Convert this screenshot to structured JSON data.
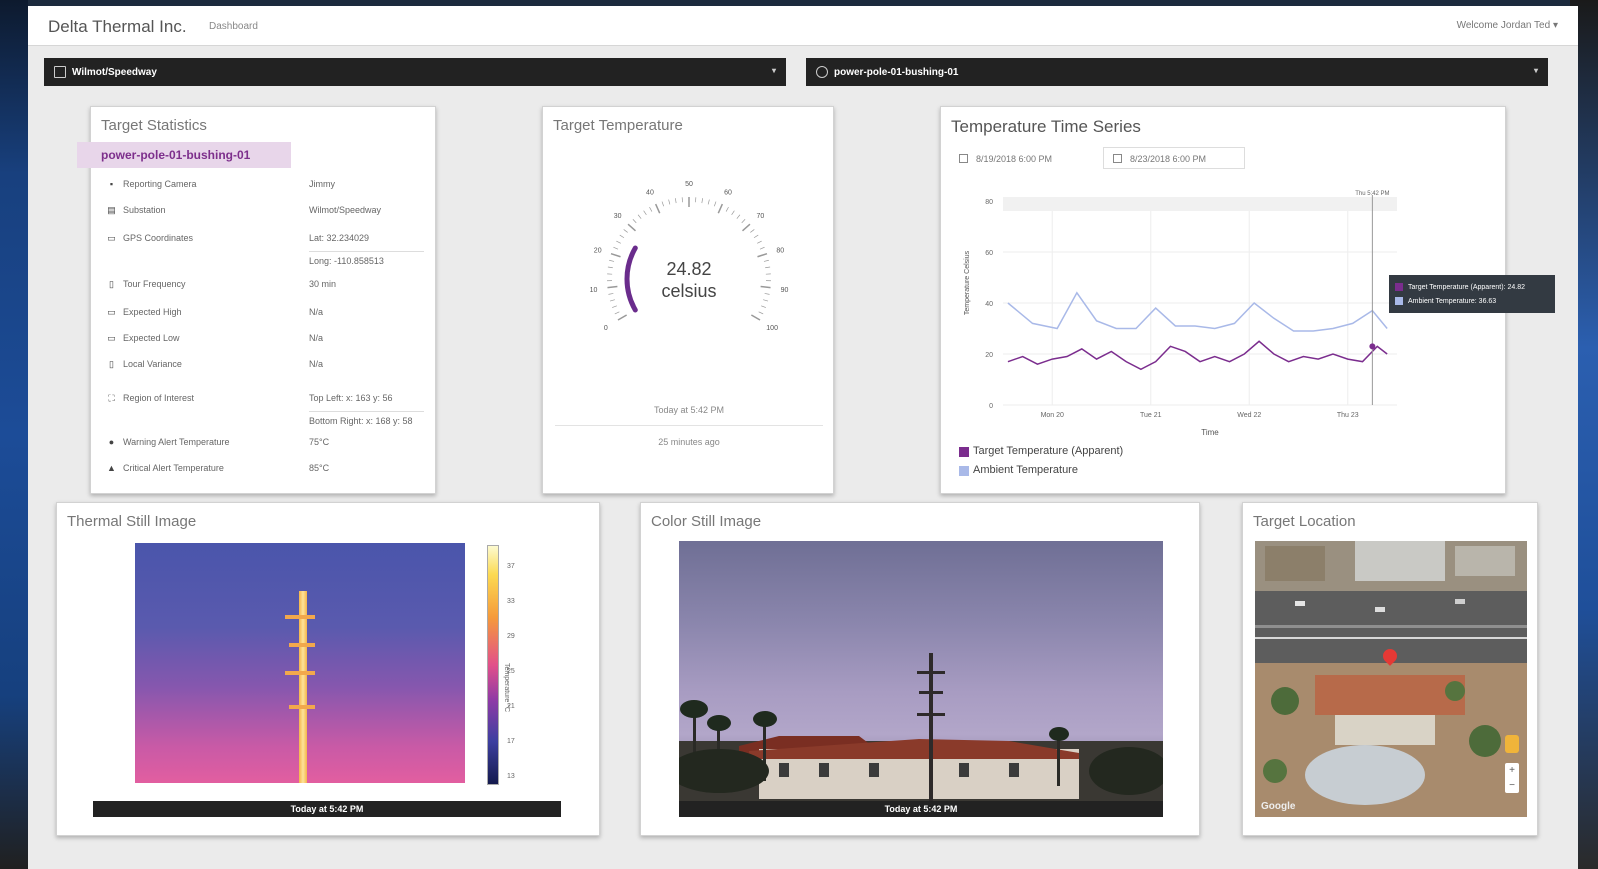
{
  "app": {
    "brand": "Delta Thermal Inc.",
    "crumb": "Dashboard",
    "welcome": "Welcome Jordan Ted"
  },
  "selectors": {
    "substation": "Wilmot/Speedway",
    "target": "power-pole-01-bushing-01"
  },
  "stats": {
    "title": "Target Statistics",
    "target_tag": "power-pole-01-bushing-01",
    "rows": [
      {
        "icon": "camera-icon",
        "label": "Reporting Camera",
        "value": "Jimmy"
      },
      {
        "icon": "building-icon",
        "label": "Substation",
        "value": "Wilmot/Speedway"
      },
      {
        "icon": "globe-icon",
        "label": "GPS Coordinates",
        "value": "Lat: 32.234029",
        "value2": "Long: -110.858513"
      },
      {
        "icon": "clock-icon",
        "label": "Tour Frequency",
        "value": "30 min"
      },
      {
        "icon": "arrow-up-icon",
        "label": "Expected High",
        "value": "N/a"
      },
      {
        "icon": "arrow-down-icon",
        "label": "Expected Low",
        "value": "N/a"
      },
      {
        "icon": "sigma-icon",
        "label": "Local Variance",
        "value": "N/a"
      },
      {
        "icon": "region-icon",
        "label": "Region of Interest",
        "value": "Top Left: x: 163 y: 56",
        "value2": "Bottom Right: x: 168 y: 58"
      },
      {
        "icon": "warning-circle-icon",
        "label": "Warning Alert Temperature",
        "value": "75°C"
      },
      {
        "icon": "warning-triangle-icon",
        "label": "Critical Alert Temperature",
        "value": "85°C"
      }
    ]
  },
  "gauge": {
    "title": "Target Temperature",
    "value": "24.82",
    "unit": "celsius",
    "min": 0,
    "max": 100,
    "ticks": [
      "0",
      "10",
      "20",
      "30",
      "40",
      "50",
      "60",
      "70",
      "80",
      "90",
      "100"
    ],
    "fraction": 0.25,
    "timestamp": "Today at 5:42 PM",
    "ago": "25 minutes ago"
  },
  "timeseries": {
    "title": "Temperature Time Series",
    "start": "8/19/2018 6:00 PM",
    "end": "8/23/2018 6:00 PM",
    "tooltip_time": "Thu 5:42 PM",
    "tooltip_target": "Target Temperature (Apparent): 24.82",
    "tooltip_ambient": "Ambient Temperature: 36.63",
    "legend_target": "Target Temperature (Apparent)",
    "legend_ambient": "Ambient Temperature",
    "color_target": "#7b2d8e",
    "color_ambient": "#a9b9e8"
  },
  "chart_data": {
    "type": "line",
    "xlabel": "Time",
    "ylabel": "Temperature Celsius",
    "ylim": [
      0,
      80
    ],
    "yticks": [
      0,
      20,
      40,
      60,
      80
    ],
    "x_ticks": [
      "Mon 20",
      "Tue 21",
      "Wed 22",
      "Thu 23"
    ],
    "x_range": [
      0,
      4
    ],
    "series": [
      {
        "name": "Ambient Temperature",
        "x": [
          0.05,
          0.3,
          0.55,
          0.75,
          0.95,
          1.15,
          1.35,
          1.55,
          1.75,
          1.95,
          2.15,
          2.35,
          2.55,
          2.75,
          2.95,
          3.15,
          3.35,
          3.55,
          3.75,
          3.9
        ],
        "values": [
          40,
          32,
          30,
          44,
          33,
          30,
          30,
          38,
          31,
          31,
          30,
          32,
          40,
          34,
          29,
          29,
          30,
          32,
          37,
          30
        ]
      },
      {
        "name": "Target Temperature (Apparent)",
        "x": [
          0.05,
          0.2,
          0.35,
          0.5,
          0.65,
          0.8,
          0.95,
          1.1,
          1.25,
          1.4,
          1.55,
          1.7,
          1.85,
          2.0,
          2.15,
          2.3,
          2.45,
          2.6,
          2.75,
          2.9,
          3.05,
          3.2,
          3.35,
          3.5,
          3.65,
          3.8,
          3.9
        ],
        "values": [
          17,
          19,
          16,
          18,
          19,
          22,
          18,
          21,
          17,
          14,
          17,
          23,
          21,
          17,
          19,
          17,
          20,
          25,
          20,
          17,
          19,
          18,
          20,
          18,
          17,
          23,
          20
        ]
      }
    ]
  },
  "thermal": {
    "title": "Thermal Still Image",
    "caption": "Today at 5:42 PM",
    "colorbar_ticks": [
      "37",
      "33",
      "29",
      "25",
      "21",
      "17",
      "13"
    ],
    "colorbar_label": "Temperature °C"
  },
  "color_image": {
    "title": "Color Still Image",
    "caption": "Today at 5:42 PM"
  },
  "location": {
    "title": "Target Location",
    "watermark": "Google"
  }
}
